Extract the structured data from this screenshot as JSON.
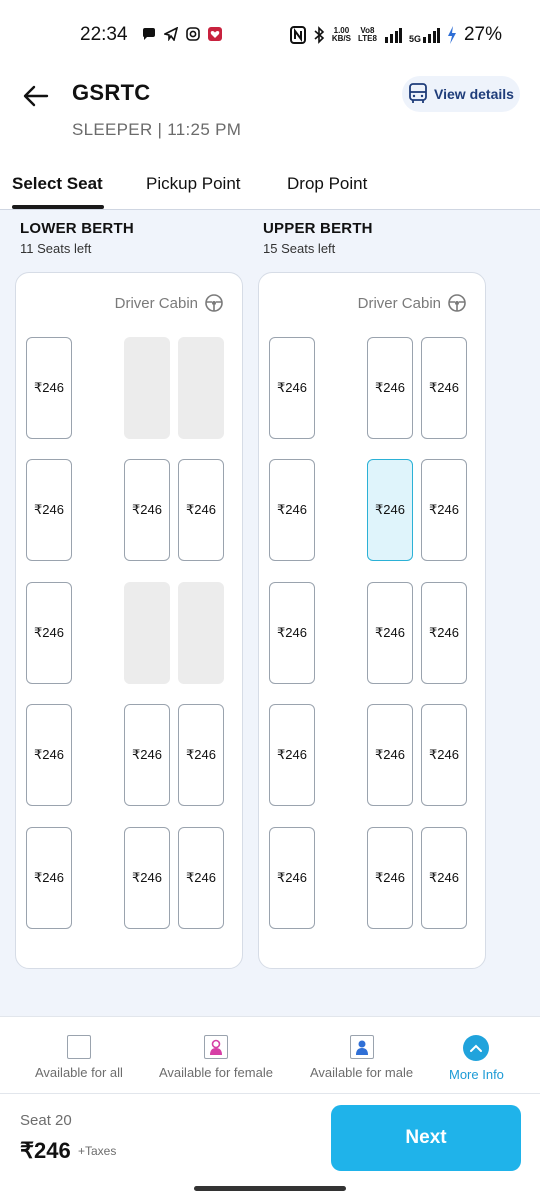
{
  "status_bar": {
    "time": "22:34",
    "net_speed_value": "1.00",
    "net_speed_unit": "KB/S",
    "volte_top": "Vo8",
    "volte_bottom": "LTE8",
    "network": "5G",
    "battery": "27%"
  },
  "header": {
    "title": "GSRTC",
    "subtitle": "SLEEPER | 11:25 PM",
    "view_details_label": "View details"
  },
  "tabs": [
    {
      "label": "Select Seat",
      "active": true
    },
    {
      "label": "Pickup Point",
      "active": false
    },
    {
      "label": "Drop Point",
      "active": false
    }
  ],
  "lower_berth": {
    "title": "LOWER BERTH",
    "seats_left": "11 Seats left",
    "driver_cabin": "Driver Cabin",
    "rows": [
      [
        {
          "price": "₹246",
          "state": "available"
        },
        {
          "price": "",
          "state": "booked"
        },
        {
          "price": "",
          "state": "booked"
        }
      ],
      [
        {
          "price": "₹246",
          "state": "available"
        },
        {
          "price": "₹246",
          "state": "available"
        },
        {
          "price": "₹246",
          "state": "available"
        }
      ],
      [
        {
          "price": "₹246",
          "state": "available"
        },
        {
          "price": "",
          "state": "booked"
        },
        {
          "price": "",
          "state": "booked"
        }
      ],
      [
        {
          "price": "₹246",
          "state": "available"
        },
        {
          "price": "₹246",
          "state": "available"
        },
        {
          "price": "₹246",
          "state": "available"
        }
      ],
      [
        {
          "price": "₹246",
          "state": "available"
        },
        {
          "price": "₹246",
          "state": "available"
        },
        {
          "price": "₹246",
          "state": "available"
        }
      ]
    ]
  },
  "upper_berth": {
    "title": "UPPER BERTH",
    "seats_left": "15 Seats left",
    "driver_cabin": "Driver Cabin",
    "rows": [
      [
        {
          "price": "₹246",
          "state": "available"
        },
        {
          "price": "₹246",
          "state": "available"
        },
        {
          "price": "₹246",
          "state": "available"
        }
      ],
      [
        {
          "price": "₹246",
          "state": "available"
        },
        {
          "price": "₹246",
          "state": "selected"
        },
        {
          "price": "₹246",
          "state": "available"
        }
      ],
      [
        {
          "price": "₹246",
          "state": "available"
        },
        {
          "price": "₹246",
          "state": "available"
        },
        {
          "price": "₹246",
          "state": "available"
        }
      ],
      [
        {
          "price": "₹246",
          "state": "available"
        },
        {
          "price": "₹246",
          "state": "available"
        },
        {
          "price": "₹246",
          "state": "available"
        }
      ],
      [
        {
          "price": "₹246",
          "state": "available"
        },
        {
          "price": "₹246",
          "state": "available"
        },
        {
          "price": "₹246",
          "state": "available"
        }
      ]
    ]
  },
  "legend": {
    "all": "Available for all",
    "female": "Available for female",
    "male": "Available for male",
    "more_info": "More Info"
  },
  "bottom": {
    "seat_label": "Seat 20",
    "price": "₹246",
    "taxes": "+Taxes",
    "next_label": "Next"
  },
  "colors": {
    "accent": "#1fb3ea",
    "selected_fill": "#dff4fb",
    "booked_fill": "#ececec",
    "female_icon": "#d63fa6",
    "male_icon": "#2f6fd6"
  }
}
